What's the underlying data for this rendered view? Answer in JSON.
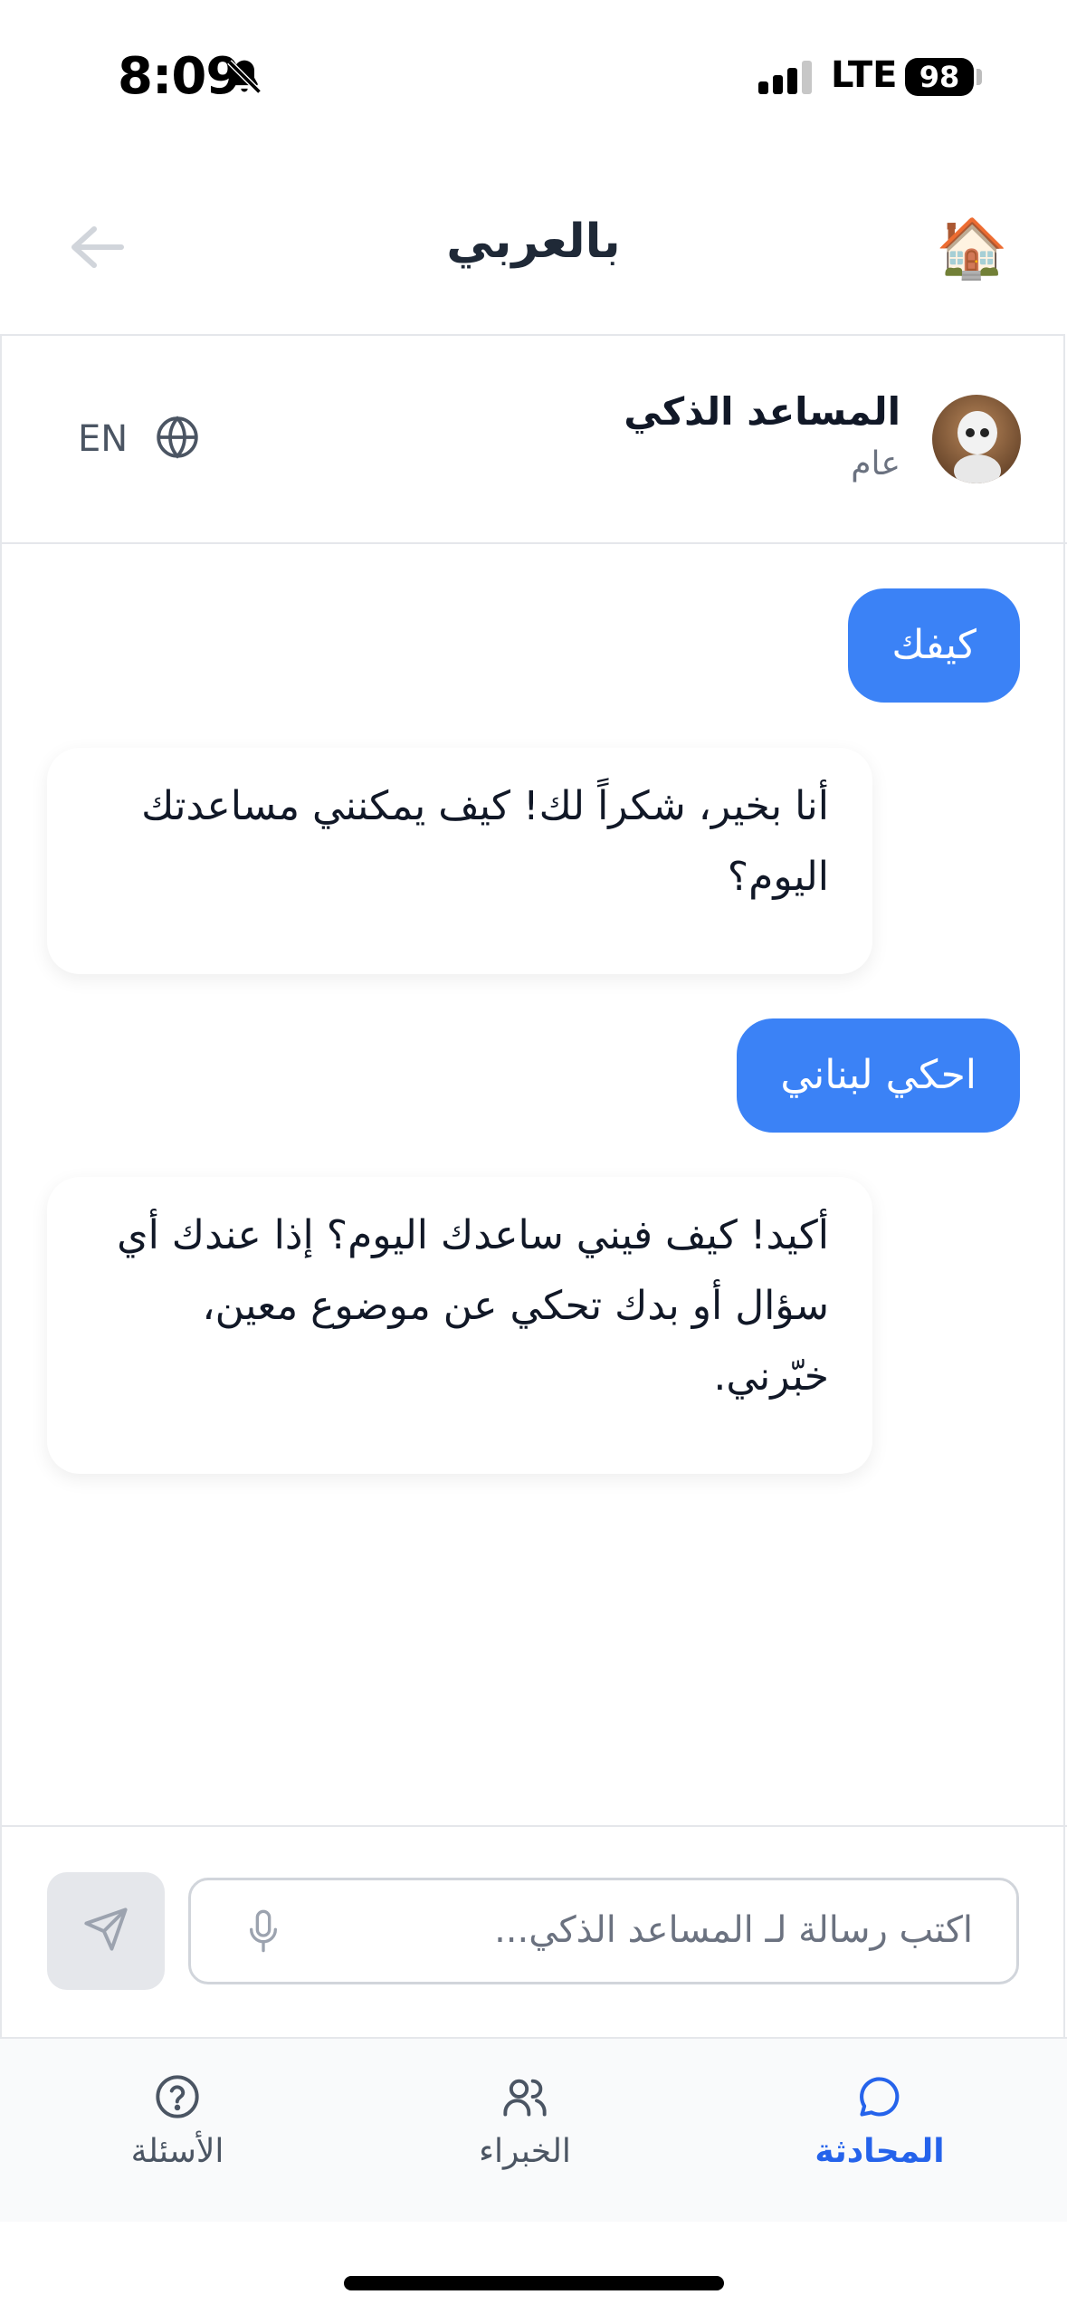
{
  "status_bar": {
    "time": "8:09",
    "network": "LTE",
    "battery": "98"
  },
  "nav": {
    "title": "بالعربي",
    "home_icon": "🏠"
  },
  "chat_header": {
    "assistant_name": "المساعد الذكي",
    "assistant_category": "عام",
    "language_toggle": "EN"
  },
  "messages": [
    {
      "role": "user",
      "text": "كيفك"
    },
    {
      "role": "assistant",
      "text": "أنا بخير، شكراً لك! كيف يمكنني مساعدتك اليوم؟"
    },
    {
      "role": "user",
      "text": "احكي لبناني"
    },
    {
      "role": "assistant",
      "text": "أكيد! كيف فيني ساعدك اليوم؟ إذا عندك أي سؤال أو بدك تحكي عن موضوع معين، خبّرني."
    }
  ],
  "composer": {
    "placeholder": "اكتب رسالة لـ المساعد الذكي..."
  },
  "tabs": [
    {
      "label": "المحادثة",
      "icon": "chat-bubble-icon",
      "active": true
    },
    {
      "label": "الخبراء",
      "icon": "users-icon",
      "active": false
    },
    {
      "label": "الأسئلة",
      "icon": "help-circle-icon",
      "active": false
    }
  ],
  "colors": {
    "accent": "#3b82f6",
    "active_tab": "#2563eb",
    "muted_text": "#6b7280"
  }
}
